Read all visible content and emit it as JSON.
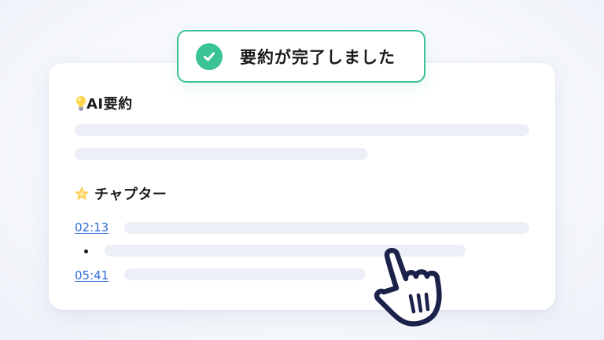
{
  "toast": {
    "message": "要約が完了しました",
    "icon": "check-circle-icon",
    "color": "#3ac493"
  },
  "summary_section": {
    "icon": "light-bulb-icon",
    "title": "AI要約"
  },
  "chapters_section": {
    "icon": "glowing-star-icon",
    "title": "チャプター",
    "items": [
      {
        "timestamp": "02:13"
      },
      {
        "timestamp": "05:41"
      }
    ]
  },
  "cursor": {
    "icon": "hand-pointer-icon"
  },
  "colors": {
    "accent": "#3ac493",
    "link": "#2f6ad9",
    "placeholder": "#edeff6"
  }
}
